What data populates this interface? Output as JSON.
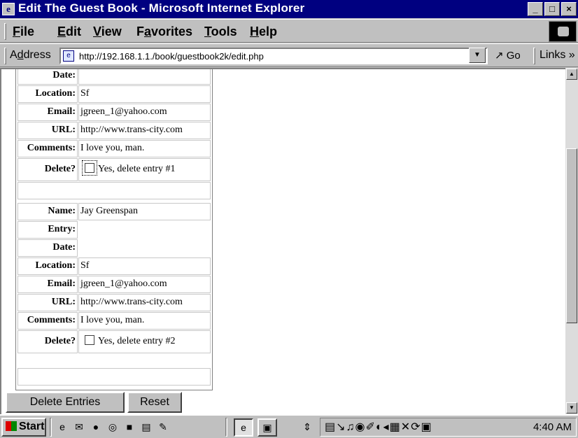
{
  "window": {
    "title": "Edit The Guest Book - Microsoft Internet Explorer",
    "app_icon": "ie-icon",
    "controls": {
      "minimize": "_",
      "maximize": "□",
      "close": "×"
    }
  },
  "menu": {
    "items": [
      {
        "label": "File",
        "hotkey": "F",
        "rest": "ile"
      },
      {
        "label": "Edit",
        "hotkey": "E",
        "rest": "dit"
      },
      {
        "label": "View",
        "hotkey": "V",
        "rest": "iew"
      },
      {
        "label": "Favorites",
        "pre": "F",
        "hotkey": "a",
        "rest": "vorites"
      },
      {
        "label": "Tools",
        "hotkey": "T",
        "rest": "ools"
      },
      {
        "label": "Help",
        "hotkey": "H",
        "rest": "elp"
      }
    ]
  },
  "address_bar": {
    "label_pre": "A",
    "label_hotkey": "d",
    "label_rest": "dress",
    "url": "http://192.168.1.1./book/guestbook2k/edit.php",
    "go_label": "Go",
    "links_label": "Links »"
  },
  "form": {
    "entry1": {
      "date_label": "Date:",
      "date_value": "",
      "location_label": "Location:",
      "location_value": "Sf",
      "email_label": "Email:",
      "email_value": "jgreen_1@yahoo.com",
      "url_label": "URL:",
      "url_value": "http://www.trans-city.com",
      "comments_label": "Comments:",
      "comments_value": "I love you, man.",
      "delete_label": "Delete?",
      "delete_text": "Yes, delete entry #1",
      "delete_checked": false
    },
    "entry2": {
      "name_label": "Name:",
      "name_value": "Jay Greenspan",
      "entry_label": "Entry:",
      "entry_value": "",
      "date_label": "Date:",
      "date_value": "",
      "location_label": "Location:",
      "location_value": "Sf",
      "email_label": "Email:",
      "email_value": "jgreen_1@yahoo.com",
      "url_label": "URL:",
      "url_value": "http://www.trans-city.com",
      "comments_label": "Comments:",
      "comments_value": "I love you, man.",
      "delete_label": "Delete?",
      "delete_text": "Yes, delete entry #2",
      "delete_checked": false
    },
    "buttons": {
      "delete_label": "Delete Entries",
      "reset_label": "Reset"
    }
  },
  "taskbar": {
    "start_label": "Start",
    "clock": "4:40 AM"
  },
  "colors": {
    "titlebar": "#000080",
    "chrome": "#c0c0c0",
    "page_background": "#ffffff"
  }
}
